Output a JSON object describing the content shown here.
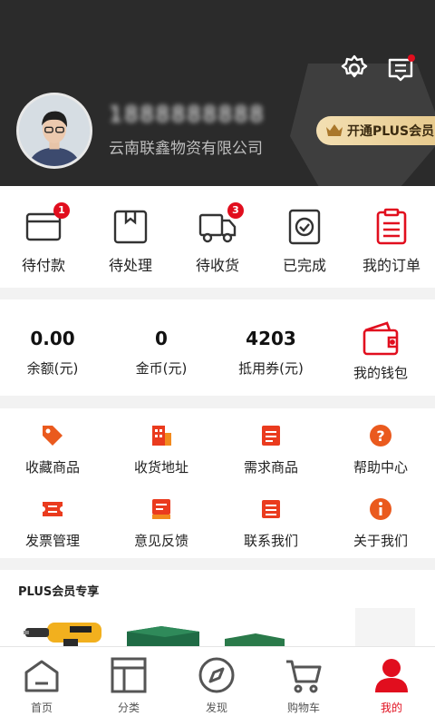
{
  "profile": {
    "phone_masked": "1888888888",
    "company": "云南联鑫物资有限公司",
    "plus_button": "开通PLUS会员"
  },
  "header_icons": [
    "settings-icon",
    "messages-icon"
  ],
  "orders": [
    {
      "label": "待付款",
      "icon": "card-icon",
      "badge": "1"
    },
    {
      "label": "待处理",
      "icon": "box-icon",
      "badge": ""
    },
    {
      "label": "待收货",
      "icon": "truck-icon",
      "badge": "3"
    },
    {
      "label": "已完成",
      "icon": "check-box-icon",
      "badge": ""
    },
    {
      "label": "我的订单",
      "icon": "clipboard-icon",
      "badge": ""
    }
  ],
  "wallet": [
    {
      "value": "0.00",
      "label": "余额(元)"
    },
    {
      "value": "0",
      "label": "金币(元)"
    },
    {
      "value": "4203",
      "label": "抵用券(元)"
    },
    {
      "label": "我的钱包",
      "icon": "wallet-icon"
    }
  ],
  "services": [
    {
      "label": "收藏商品",
      "icon": "tag-icon"
    },
    {
      "label": "收货地址",
      "icon": "building-icon"
    },
    {
      "label": "需求商品",
      "icon": "document-icon"
    },
    {
      "label": "帮助中心",
      "icon": "help-icon"
    },
    {
      "label": "发票管理",
      "icon": "ticket-icon"
    },
    {
      "label": "意见反馈",
      "icon": "feedback-icon"
    },
    {
      "label": "联系我们",
      "icon": "contact-icon"
    },
    {
      "label": "关于我们",
      "icon": "info-icon"
    }
  ],
  "plus_section": {
    "title": "PLUS会员专享"
  },
  "tabbar": [
    {
      "label": "首页",
      "icon": "home-icon"
    },
    {
      "label": "分类",
      "icon": "category-icon"
    },
    {
      "label": "发现",
      "icon": "compass-icon"
    },
    {
      "label": "购物车",
      "icon": "cart-icon"
    },
    {
      "label": "我的",
      "icon": "profile-icon",
      "active": true
    }
  ],
  "colors": {
    "accent": "#e10e1e",
    "header_bg": "#2b2b2b",
    "plus_gold": "#e6c98c"
  }
}
